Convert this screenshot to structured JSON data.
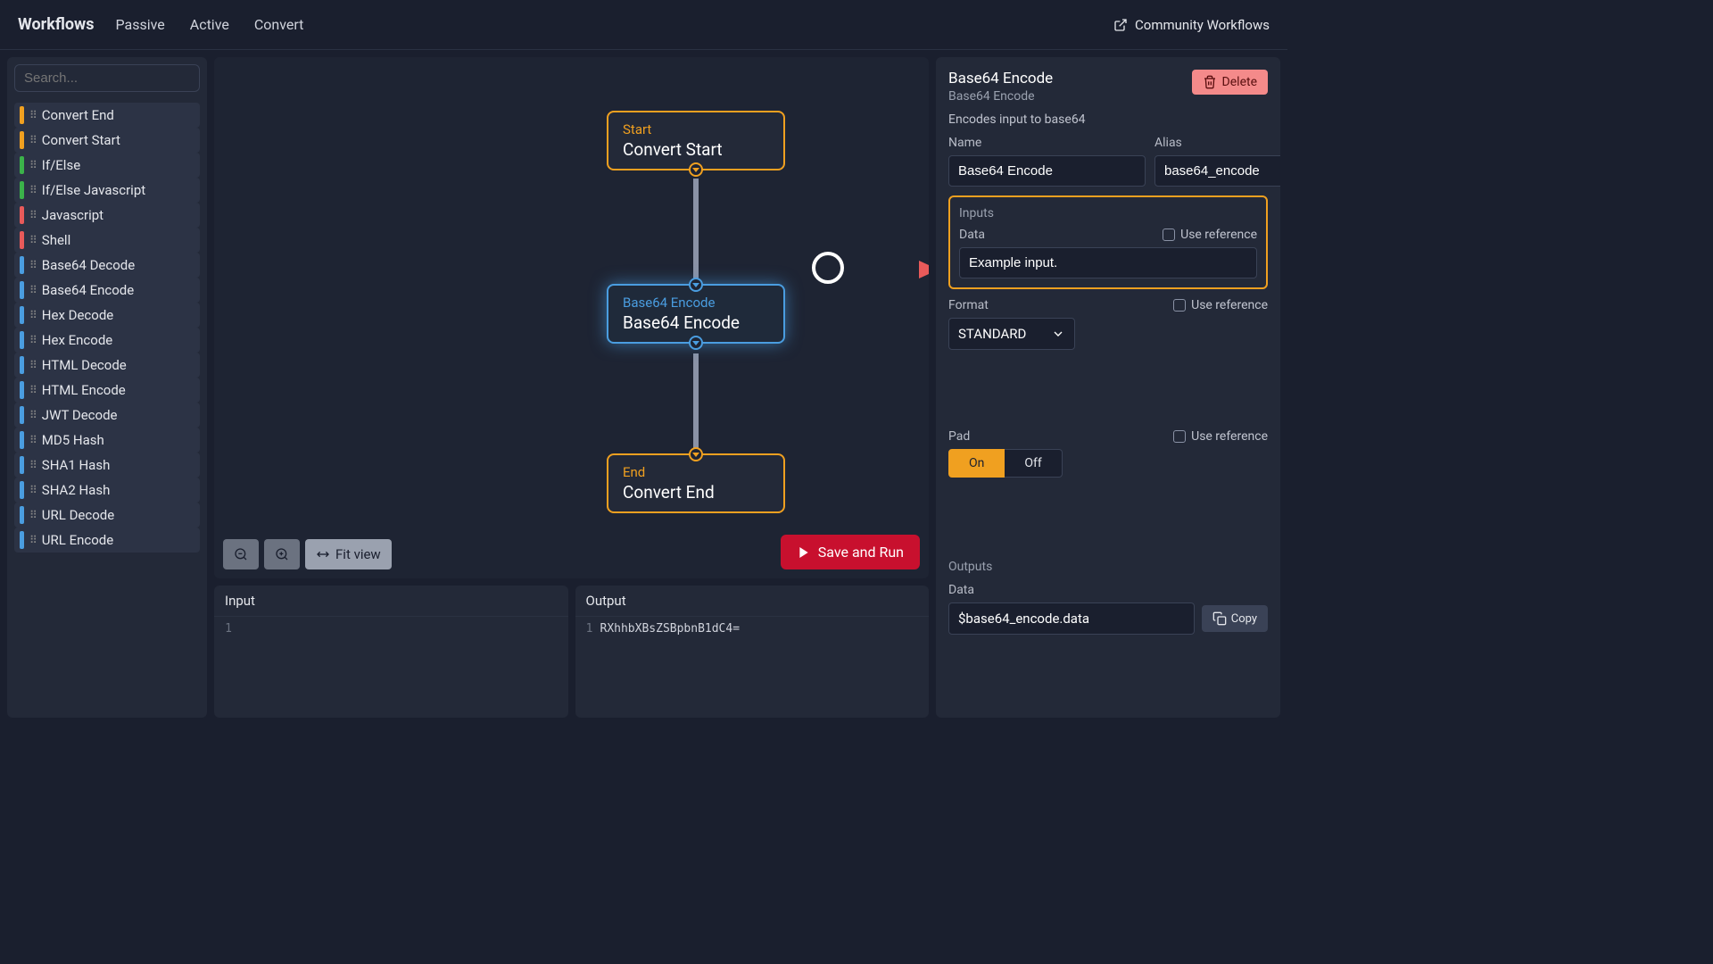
{
  "nav": {
    "brand": "Workflows",
    "links": [
      "Passive",
      "Active",
      "Convert"
    ],
    "community": "Community Workflows"
  },
  "sidebar": {
    "search_placeholder": "Search...",
    "nodes": [
      {
        "label": "Convert End",
        "color": "orange"
      },
      {
        "label": "Convert Start",
        "color": "orange"
      },
      {
        "label": "If/Else",
        "color": "green"
      },
      {
        "label": "If/Else Javascript",
        "color": "green"
      },
      {
        "label": "Javascript",
        "color": "red"
      },
      {
        "label": "Shell",
        "color": "red"
      },
      {
        "label": "Base64 Decode",
        "color": "blue"
      },
      {
        "label": "Base64 Encode",
        "color": "blue"
      },
      {
        "label": "Hex Decode",
        "color": "blue"
      },
      {
        "label": "Hex Encode",
        "color": "blue"
      },
      {
        "label": "HTML Decode",
        "color": "blue"
      },
      {
        "label": "HTML Encode",
        "color": "blue"
      },
      {
        "label": "JWT Decode",
        "color": "blue"
      },
      {
        "label": "MD5 Hash",
        "color": "blue"
      },
      {
        "label": "SHA1 Hash",
        "color": "blue"
      },
      {
        "label": "SHA2 Hash",
        "color": "blue"
      },
      {
        "label": "URL Decode",
        "color": "blue"
      },
      {
        "label": "URL Encode",
        "color": "blue"
      }
    ]
  },
  "canvas": {
    "nodes": [
      {
        "type": "Start",
        "title": "Convert Start",
        "color": "orange"
      },
      {
        "type": "Base64 Encode",
        "title": "Base64 Encode",
        "color": "blue"
      },
      {
        "type": "End",
        "title": "Convert End",
        "color": "orange"
      }
    ],
    "toolbar": {
      "fit_view": "Fit view"
    },
    "run_btn": "Save and Run"
  },
  "io": {
    "input_label": "Input",
    "output_label": "Output",
    "input_lines": [
      ""
    ],
    "output_lines": [
      "RXhhbXBsZSBpbnB1dC4="
    ]
  },
  "props": {
    "title": "Base64 Encode",
    "subtitle": "Base64 Encode",
    "delete": "Delete",
    "description": "Encodes input to base64",
    "name_label": "Name",
    "name_value": "Base64 Encode",
    "alias_label": "Alias",
    "alias_value": "base64_encode",
    "inputs_label": "Inputs",
    "data_label": "Data",
    "use_reference": "Use reference",
    "data_value": "Example input.",
    "format_label": "Format",
    "format_value": "STANDARD",
    "pad_label": "Pad",
    "pad_on": "On",
    "pad_off": "Off",
    "outputs_label": "Outputs",
    "output_data_label": "Data",
    "output_expr": "$base64_encode.data",
    "copy": "Copy"
  }
}
